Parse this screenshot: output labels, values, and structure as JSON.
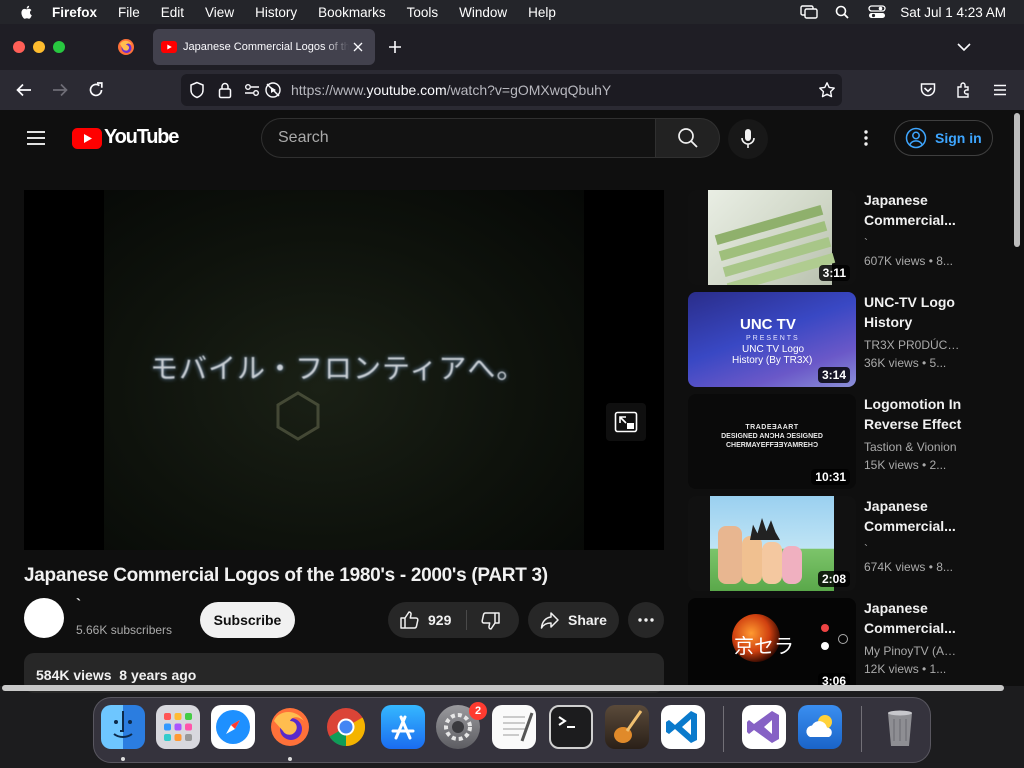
{
  "menubar": {
    "app": "Firefox",
    "items": [
      "File",
      "Edit",
      "View",
      "History",
      "Bookmarks",
      "Tools",
      "Window",
      "Help"
    ],
    "clock": "Sat Jul 1  4:23 AM"
  },
  "browser": {
    "tab_title": "Japanese Commercial Logos of the 1980's - 2000's (PART 3)",
    "url_prefix": "https://www.",
    "url_domain": "youtube.com",
    "url_path": "/watch?v=gOMXwqQbuhY"
  },
  "youtube": {
    "wordmark": "YouTube",
    "search_placeholder": "Search",
    "signin_label": "Sign in"
  },
  "video": {
    "caption": "モバイル・フロンティアへ。",
    "title": "Japanese Commercial Logos of the 1980's - 2000's (PART 3)",
    "channel": "`",
    "subscribers": "5.66K subscribers",
    "subscribe_label": "Subscribe",
    "likes": "929",
    "share_label": "Share",
    "views": "584K views",
    "age": "8 years ago"
  },
  "related": [
    {
      "title_1": "Japanese",
      "title_2": "Commercial...",
      "channel": "`",
      "meta": "607K views  • 8...",
      "duration": "3:11"
    },
    {
      "title_1": "UNC-TV Logo",
      "title_2": "History",
      "channel": "TR3X PR0DÚCTÍ...",
      "meta": "36K views  • 5...",
      "duration": "3:14",
      "thumb_text_1": "UNC TV",
      "thumb_text_2": "PRESENTS",
      "thumb_text_3": "UNC TV Logo",
      "thumb_text_4": "History (By TR3X)"
    },
    {
      "title_1": "Logomotion In",
      "title_2": "Reverse Effect",
      "channel": "Tastion & Vionion",
      "meta": "15K views  • 2...",
      "duration": "10:31",
      "thumb_text_1": "TRADEƎAART",
      "thumb_text_2": "DESIGNED ANƆHA ƆESIGNED",
      "thumb_text_3": "CHERMAYEFFƎƎYAMREHƆ"
    },
    {
      "title_1": "Japanese",
      "title_2": "Commercial...",
      "channel": "`",
      "meta": "674K views  • 8...",
      "duration": "2:08"
    },
    {
      "title_1": "Japanese",
      "title_2": "Commercial...",
      "channel": "My PinoyTV (ASI...",
      "meta": "12K views  • 1...",
      "duration": "3:06",
      "thumb_text_1": "京セラ"
    }
  ],
  "dock": {
    "badge_settings": "2",
    "apps": [
      "Finder",
      "Launchpad",
      "Safari",
      "Firefox",
      "Chrome",
      "App Store",
      "System Settings",
      "TextEdit",
      "Terminal",
      "GarageBand",
      "Visual Studio Code",
      "Visual Studio",
      "Weather",
      "Trash"
    ]
  },
  "colors": {
    "yt_red": "#ff0000",
    "link_blue": "#3ea6ff",
    "page_bg": "#0f0f0f"
  }
}
